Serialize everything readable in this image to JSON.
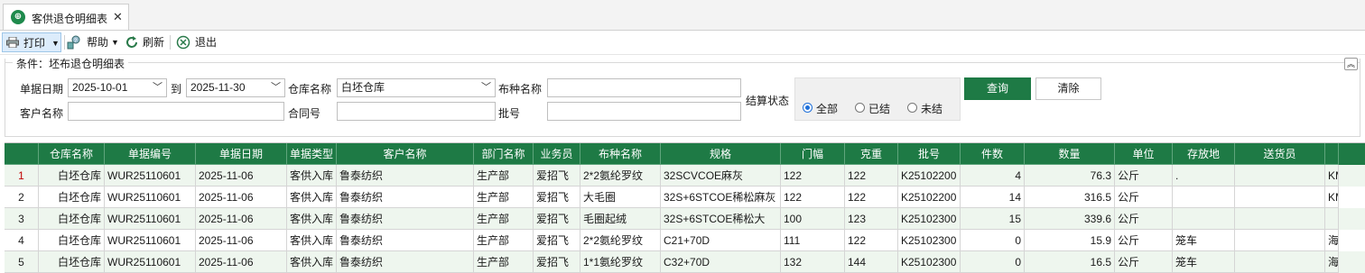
{
  "tab": {
    "title": "客供退仓明细表",
    "close": "✕",
    "icon": "tab-app-icon"
  },
  "toolbar": {
    "print_label": "打印",
    "help_label": "帮助",
    "refresh_label": "刷新",
    "exit_label": "退出",
    "dropdown_glyph": "▼"
  },
  "conditions": {
    "section_title": "条件：坯布退仓明细表",
    "collapse_glyph": "︽",
    "date_label": "单据日期",
    "date_from": "2025-10-01",
    "to_label": "到",
    "date_to": "2025-11-30",
    "warehouse_label": "仓库名称",
    "warehouse_value": "白坯仓库",
    "fabric_label": "布种名称",
    "fabric_value": "",
    "customer_label": "客户名称",
    "customer_value": "",
    "contract_label": "合同号",
    "contract_value": "",
    "batch_label": "批号",
    "batch_value": "",
    "settle_label": "结算状态",
    "settle_options": [
      "全部",
      "已结",
      "未结"
    ],
    "settle_selected": "全部",
    "query_label": "查询",
    "clear_label": "清除"
  },
  "grid": {
    "headers": [
      "仓库名称",
      "单据编号",
      "单据日期",
      "单据类型",
      "客户名称",
      "部门名称",
      "业务员",
      "布种名称",
      "规格",
      "门幅",
      "克重",
      "批号",
      "件数",
      "数量",
      "单位",
      "存放地",
      "送货员"
    ],
    "rows": [
      {
        "no": "1",
        "wh": "白坯仓库",
        "code": "WUR25110601",
        "date": "2025-11-06",
        "type": "客供入库",
        "cust": "鲁泰纺织",
        "dept": "生产部",
        "sales": "爱招飞",
        "fabric": "2*2氨纶罗纹",
        "spec": "32SCVCOE麻灰",
        "width": "122",
        "weight": "122",
        "batch": "K25102200",
        "pieces": "4",
        "qty": "76.3",
        "unit": "公斤",
        "loc": ".",
        "deliver": "",
        "extra": "KM"
      },
      {
        "no": "2",
        "wh": "白坯仓库",
        "code": "WUR25110601",
        "date": "2025-11-06",
        "type": "客供入库",
        "cust": "鲁泰纺织",
        "dept": "生产部",
        "sales": "爱招飞",
        "fabric": "大毛圈",
        "spec": "32S+6STCOE稀松麻灰",
        "width": "122",
        "weight": "122",
        "batch": "K25102200",
        "pieces": "14",
        "qty": "316.5",
        "unit": "公斤",
        "loc": "",
        "deliver": "",
        "extra": "KM"
      },
      {
        "no": "3",
        "wh": "白坯仓库",
        "code": "WUR25110601",
        "date": "2025-11-06",
        "type": "客供入库",
        "cust": "鲁泰纺织",
        "dept": "生产部",
        "sales": "爱招飞",
        "fabric": "毛圈起绒",
        "spec": "32S+6STCOE稀松大",
        "width": "100",
        "weight": "123",
        "batch": "K25102300",
        "pieces": "15",
        "qty": "339.6",
        "unit": "公斤",
        "loc": "",
        "deliver": "",
        "extra": ""
      },
      {
        "no": "4",
        "wh": "白坯仓库",
        "code": "WUR25110601",
        "date": "2025-11-06",
        "type": "客供入库",
        "cust": "鲁泰纺织",
        "dept": "生产部",
        "sales": "爱招飞",
        "fabric": "2*2氨纶罗纹",
        "spec": "C21+70D",
        "width": "111",
        "weight": "122",
        "batch": "K25102300",
        "pieces": "0",
        "qty": "15.9",
        "unit": "公斤",
        "loc": "笼车",
        "deliver": "",
        "extra": "海阳"
      },
      {
        "no": "5",
        "wh": "白坯仓库",
        "code": "WUR25110601",
        "date": "2025-11-06",
        "type": "客供入库",
        "cust": "鲁泰纺织",
        "dept": "生产部",
        "sales": "爱招飞",
        "fabric": "1*1氨纶罗纹",
        "spec": "C32+70D",
        "width": "132",
        "weight": "144",
        "batch": "K25102300",
        "pieces": "0",
        "qty": "16.5",
        "unit": "公斤",
        "loc": "笼车",
        "deliver": "",
        "extra": "海阳"
      }
    ]
  }
}
